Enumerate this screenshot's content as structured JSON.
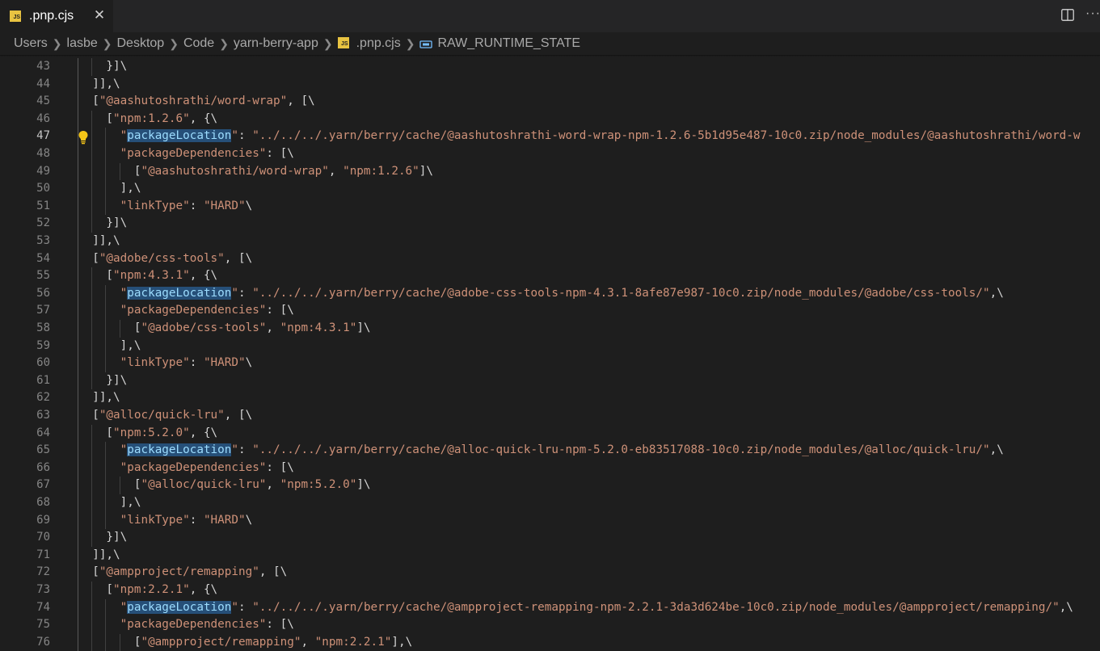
{
  "tab": {
    "icon": "js-file-icon",
    "badge_text": "JS",
    "label": ".pnp.cjs",
    "close": "✕"
  },
  "actions": {
    "more": "···"
  },
  "breadcrumb": {
    "items": [
      "Users",
      "lasbe",
      "Desktop",
      "Code",
      "yarn-berry-app"
    ],
    "file": ".pnp.cjs",
    "symbol": "RAW_RUNTIME_STATE"
  },
  "editor": {
    "active_line": 47,
    "lines": [
      {
        "n": 43,
        "text": "    }]\\"
      },
      {
        "n": 44,
        "text": "  ]],\\"
      },
      {
        "n": 45,
        "text": "  [\"@aashutoshrathi/word-wrap\", [\\"
      },
      {
        "n": 46,
        "text": "    [\"npm:1.2.6\", {\\"
      },
      {
        "n": 47,
        "text": "      \"packageLocation\": \"../../../.yarn/berry/cache/@aashutoshrathi-word-wrap-npm-1.2.6-5b1d95e487-10c0.zip/node_modules/@aashutoshrathi/word-w"
      },
      {
        "n": 48,
        "text": "      \"packageDependencies\": [\\"
      },
      {
        "n": 49,
        "text": "        [\"@aashutoshrathi/word-wrap\", \"npm:1.2.6\"]\\"
      },
      {
        "n": 50,
        "text": "      ],\\"
      },
      {
        "n": 51,
        "text": "      \"linkType\": \"HARD\"\\"
      },
      {
        "n": 52,
        "text": "    }]\\"
      },
      {
        "n": 53,
        "text": "  ]],\\"
      },
      {
        "n": 54,
        "text": "  [\"@adobe/css-tools\", [\\"
      },
      {
        "n": 55,
        "text": "    [\"npm:4.3.1\", {\\"
      },
      {
        "n": 56,
        "text": "      \"packageLocation\": \"../../../.yarn/berry/cache/@adobe-css-tools-npm-4.3.1-8afe87e987-10c0.zip/node_modules/@adobe/css-tools/\",\\"
      },
      {
        "n": 57,
        "text": "      \"packageDependencies\": [\\"
      },
      {
        "n": 58,
        "text": "        [\"@adobe/css-tools\", \"npm:4.3.1\"]\\"
      },
      {
        "n": 59,
        "text": "      ],\\"
      },
      {
        "n": 60,
        "text": "      \"linkType\": \"HARD\"\\"
      },
      {
        "n": 61,
        "text": "    }]\\"
      },
      {
        "n": 62,
        "text": "  ]],\\"
      },
      {
        "n": 63,
        "text": "  [\"@alloc/quick-lru\", [\\"
      },
      {
        "n": 64,
        "text": "    [\"npm:5.2.0\", {\\"
      },
      {
        "n": 65,
        "text": "      \"packageLocation\": \"../../../.yarn/berry/cache/@alloc-quick-lru-npm-5.2.0-eb83517088-10c0.zip/node_modules/@alloc/quick-lru/\",\\"
      },
      {
        "n": 66,
        "text": "      \"packageDependencies\": [\\"
      },
      {
        "n": 67,
        "text": "        [\"@alloc/quick-lru\", \"npm:5.2.0\"]\\"
      },
      {
        "n": 68,
        "text": "      ],\\"
      },
      {
        "n": 69,
        "text": "      \"linkType\": \"HARD\"\\"
      },
      {
        "n": 70,
        "text": "    }]\\"
      },
      {
        "n": 71,
        "text": "  ]],\\"
      },
      {
        "n": 72,
        "text": "  [\"@ampproject/remapping\", [\\"
      },
      {
        "n": 73,
        "text": "    [\"npm:2.2.1\", {\\"
      },
      {
        "n": 74,
        "text": "      \"packageLocation\": \"../../../.yarn/berry/cache/@ampproject-remapping-npm-2.2.1-3da3d624be-10c0.zip/node_modules/@ampproject/remapping/\",\\"
      },
      {
        "n": 75,
        "text": "      \"packageDependencies\": [\\"
      },
      {
        "n": 76,
        "text": "        [\"@ampproject/remapping\", \"npm:2.2.1\"],\\"
      }
    ],
    "highlight_word": "packageLocation",
    "colors": {
      "background": "#1e1e1e",
      "string": "#ce9178",
      "punctuation": "#d4d4d4",
      "selection_highlight": "#264f78",
      "line_number": "#858585",
      "js_badge": "#e8c341"
    }
  }
}
